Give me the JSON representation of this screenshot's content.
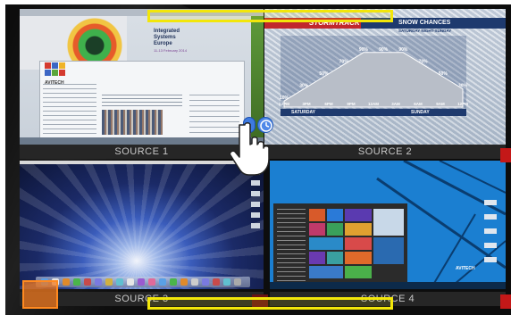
{
  "sources": [
    {
      "label": "SOURCE 1",
      "content": {
        "expo_title_line1": "Integrated",
        "expo_title_line2": "Systems",
        "expo_title_line3": "Europe",
        "expo_dates": "11-13 February 2014",
        "brand": "AVITECH"
      }
    },
    {
      "label": "SOURCE 2",
      "content": {
        "brand": "STORMTRACK",
        "heading": "SNOW CHANCES",
        "subheading": "SATURDAY NIGHT-SUNDAY",
        "percent_labels": [
          "10%",
          "30%",
          "50%",
          "70%",
          "90%",
          "90%",
          "90%",
          "70%",
          "50%",
          "30%"
        ],
        "time_labels": [
          "12PM",
          "3PM",
          "6PM",
          "9PM",
          "12AM",
          "3AM",
          "6AM",
          "9AM",
          "12PM"
        ],
        "day_labels": [
          "SATURDAY",
          "SUNDAY"
        ]
      }
    },
    {
      "label": "SOURCE 3"
    },
    {
      "label": "SOURCE 4",
      "content": {
        "brand": "AVITECH"
      }
    }
  ],
  "colors": {
    "highlight": "#f2e60a",
    "marker": "#f0781e",
    "alert": "#c41818",
    "caption_text": "#c8c8c8"
  },
  "icons": [
    "hand-pointer-icon",
    "clock-icon",
    "scroll-handle-icon"
  ]
}
